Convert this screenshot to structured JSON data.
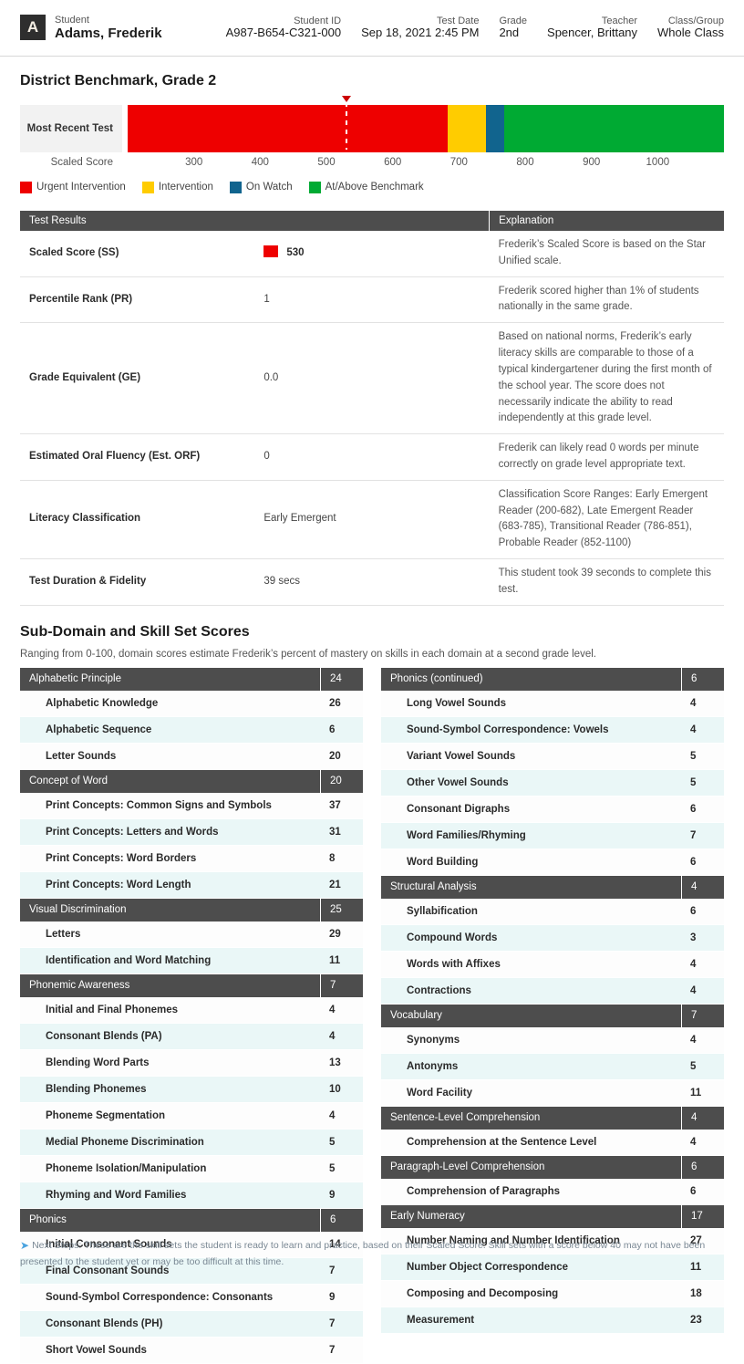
{
  "header": {
    "avatar_initial": "A",
    "fields": [
      {
        "label": "Student",
        "value": "Adams, Frederik"
      },
      {
        "label": "Student ID",
        "value": "A987-B654-C321-000"
      },
      {
        "label": "Test Date",
        "value": "Sep 18, 2021 2:45 PM"
      },
      {
        "label": "Grade",
        "value": "2nd"
      },
      {
        "label": "Teacher",
        "value": "Spencer, Brittany"
      },
      {
        "label": "Class/Group",
        "value": "Whole Class"
      }
    ]
  },
  "benchmark": {
    "title": "District Benchmark, Grade 2",
    "row_label": "Most Recent Test",
    "axis_title": "Scaled Score",
    "ticks": [
      "300",
      "400",
      "500",
      "600",
      "700",
      "800",
      "900",
      "1000"
    ],
    "legend": [
      {
        "label": "Urgent Intervention",
        "color": "#ee0000"
      },
      {
        "label": "Intervention",
        "color": "#ffcc00"
      },
      {
        "label": "On Watch",
        "color": "#11648e"
      },
      {
        "label": "At/Above Benchmark",
        "color": "#00aa33"
      }
    ],
    "marker_score": 530
  },
  "chart_data": {
    "type": "bar",
    "title": "District Benchmark, Grade 2",
    "xlabel": "Scaled Score",
    "ylabel": "",
    "xlim": [
      200,
      1100
    ],
    "categories": [
      "Most Recent Test"
    ],
    "values": [
      530
    ],
    "bands": [
      {
        "name": "Urgent Intervention",
        "range": [
          200,
          682
        ],
        "color": "#ee0000"
      },
      {
        "name": "Intervention",
        "range": [
          683,
          740
        ],
        "color": "#ffcc00"
      },
      {
        "name": "On Watch",
        "range": [
          741,
          767
        ],
        "color": "#11648e"
      },
      {
        "name": "At/Above Benchmark",
        "range": [
          768,
          1100
        ],
        "color": "#00aa33"
      }
    ],
    "ticks": [
      300,
      400,
      500,
      600,
      700,
      800,
      900,
      1000
    ],
    "grid": false,
    "legend_position": "bottom-left"
  },
  "results_table": {
    "headers": [
      "Test Results",
      "Explanation"
    ],
    "rows": [
      {
        "key": "Scaled Score (SS)",
        "value": "530",
        "swatch": "#ee0000",
        "explanation": "Frederik’s Scaled Score is based on the Star Unified scale."
      },
      {
        "key": "Percentile Rank (PR)",
        "value": "1",
        "explanation": "Frederik scored higher than 1% of students nationally in the same grade."
      },
      {
        "key": "Grade Equivalent (GE)",
        "value": "0.0",
        "explanation": "Based on national norms, Frederik’s early literacy skills are comparable to those of a typical kindergartener during the first month of the school year. The score does not necessarily indicate the ability to read independently at this grade level."
      },
      {
        "key": "Estimated Oral Fluency (Est. ORF)",
        "value": "0",
        "explanation": "Frederik can likely read 0 words per minute correctly on grade level appropriate text."
      },
      {
        "key": "Literacy Classification",
        "value": "Early Emergent",
        "explanation": "Classification Score Ranges: Early Emergent Reader (200-682), Late Emergent Reader (683-785), Transitional Reader (786-851), Probable Reader (852-1100)"
      },
      {
        "key": "Test Duration & Fidelity",
        "value": "39 secs",
        "explanation": "This student took 39 seconds to complete this test."
      }
    ]
  },
  "subdomain": {
    "title": "Sub-Domain and Skill Set Scores",
    "description": "Ranging from 0-100, domain scores estimate Frederik’s percent of mastery on skills in each domain at a second grade level.",
    "left_column": [
      {
        "type": "domain",
        "name": "Alphabetic Principle",
        "score": "24"
      },
      {
        "type": "skill",
        "name": "Alphabetic Knowledge",
        "score": "26"
      },
      {
        "type": "skill",
        "name": "Alphabetic Sequence",
        "score": "6"
      },
      {
        "type": "skill",
        "name": "Letter Sounds",
        "score": "20"
      },
      {
        "type": "domain",
        "name": "Concept of Word",
        "score": "20"
      },
      {
        "type": "skill",
        "name": "Print Concepts: Common Signs and Symbols",
        "score": "37"
      },
      {
        "type": "skill",
        "name": "Print Concepts: Letters and Words",
        "score": "31"
      },
      {
        "type": "skill",
        "name": "Print Concepts: Word Borders",
        "score": "8"
      },
      {
        "type": "skill",
        "name": "Print Concepts: Word Length",
        "score": "21"
      },
      {
        "type": "domain",
        "name": "Visual Discrimination",
        "score": "25"
      },
      {
        "type": "skill",
        "name": "Letters",
        "score": "29"
      },
      {
        "type": "skill",
        "name": "Identification and Word Matching",
        "score": "11"
      },
      {
        "type": "domain",
        "name": "Phonemic Awareness",
        "score": "7"
      },
      {
        "type": "skill",
        "name": "Initial and Final Phonemes",
        "score": "4"
      },
      {
        "type": "skill",
        "name": "Consonant Blends (PA)",
        "score": "4"
      },
      {
        "type": "skill",
        "name": "Blending Word Parts",
        "score": "13"
      },
      {
        "type": "skill",
        "name": "Blending Phonemes",
        "score": "10"
      },
      {
        "type": "skill",
        "name": "Phoneme Segmentation",
        "score": "4"
      },
      {
        "type": "skill",
        "name": "Medial Phoneme Discrimination",
        "score": "5"
      },
      {
        "type": "skill",
        "name": "Phoneme Isolation/Manipulation",
        "score": "5"
      },
      {
        "type": "skill",
        "name": "Rhyming and Word Families",
        "score": "9"
      },
      {
        "type": "domain",
        "name": "Phonics",
        "score": "6"
      },
      {
        "type": "skill",
        "name": "Initial Consonant Sounds",
        "score": "14"
      },
      {
        "type": "skill",
        "name": "Final Consonant Sounds",
        "score": "7"
      },
      {
        "type": "skill",
        "name": "Sound-Symbol Correspondence: Consonants",
        "score": "9"
      },
      {
        "type": "skill",
        "name": "Consonant Blends (PH)",
        "score": "7"
      },
      {
        "type": "skill",
        "name": "Short Vowel Sounds",
        "score": "7"
      }
    ],
    "right_column": [
      {
        "type": "domain",
        "name": "Phonics (continued)",
        "score": "6"
      },
      {
        "type": "skill",
        "name": "Long Vowel Sounds",
        "score": "4"
      },
      {
        "type": "skill",
        "name": "Sound-Symbol Correspondence: Vowels",
        "score": "4"
      },
      {
        "type": "skill",
        "name": "Variant Vowel Sounds",
        "score": "5"
      },
      {
        "type": "skill",
        "name": "Other Vowel Sounds",
        "score": "5"
      },
      {
        "type": "skill",
        "name": "Consonant Digraphs",
        "score": "6"
      },
      {
        "type": "skill",
        "name": "Word Families/Rhyming",
        "score": "7"
      },
      {
        "type": "skill",
        "name": "Word Building",
        "score": "6"
      },
      {
        "type": "domain",
        "name": "Structural Analysis",
        "score": "4"
      },
      {
        "type": "skill",
        "name": "Syllabification",
        "score": "6"
      },
      {
        "type": "skill",
        "name": "Compound Words",
        "score": "3"
      },
      {
        "type": "skill",
        "name": "Words with Affixes",
        "score": "4"
      },
      {
        "type": "skill",
        "name": "Contractions",
        "score": "4"
      },
      {
        "type": "domain",
        "name": "Vocabulary",
        "score": "7"
      },
      {
        "type": "skill",
        "name": "Synonyms",
        "score": "4"
      },
      {
        "type": "skill",
        "name": "Antonyms",
        "score": "5"
      },
      {
        "type": "skill",
        "name": "Word Facility",
        "score": "11"
      },
      {
        "type": "domain",
        "name": "Sentence-Level Comprehension",
        "score": "4"
      },
      {
        "type": "skill",
        "name": "Comprehension at the Sentence Level",
        "score": "4"
      },
      {
        "type": "domain",
        "name": "Paragraph-Level Comprehension",
        "score": "6"
      },
      {
        "type": "skill",
        "name": "Comprehension of Paragraphs",
        "score": "6"
      },
      {
        "type": "domain",
        "name": "Early Numeracy",
        "score": "17"
      },
      {
        "type": "skill",
        "name": "Number Naming and Number Identification",
        "score": "27"
      },
      {
        "type": "skill",
        "name": "Number Object Correspondence",
        "score": "11"
      },
      {
        "type": "skill",
        "name": "Composing and Decomposing",
        "score": "18"
      },
      {
        "type": "skill",
        "name": "Measurement",
        "score": "23"
      }
    ]
  },
  "footer": {
    "icon": "arrow-right-icon",
    "text": "Next Steps: These are the skill sets the student is ready to learn and practice, based on their Scaled Score. Skill sets with a score below 40 may not have been presented to the student yet or may be too difficult at this time."
  }
}
